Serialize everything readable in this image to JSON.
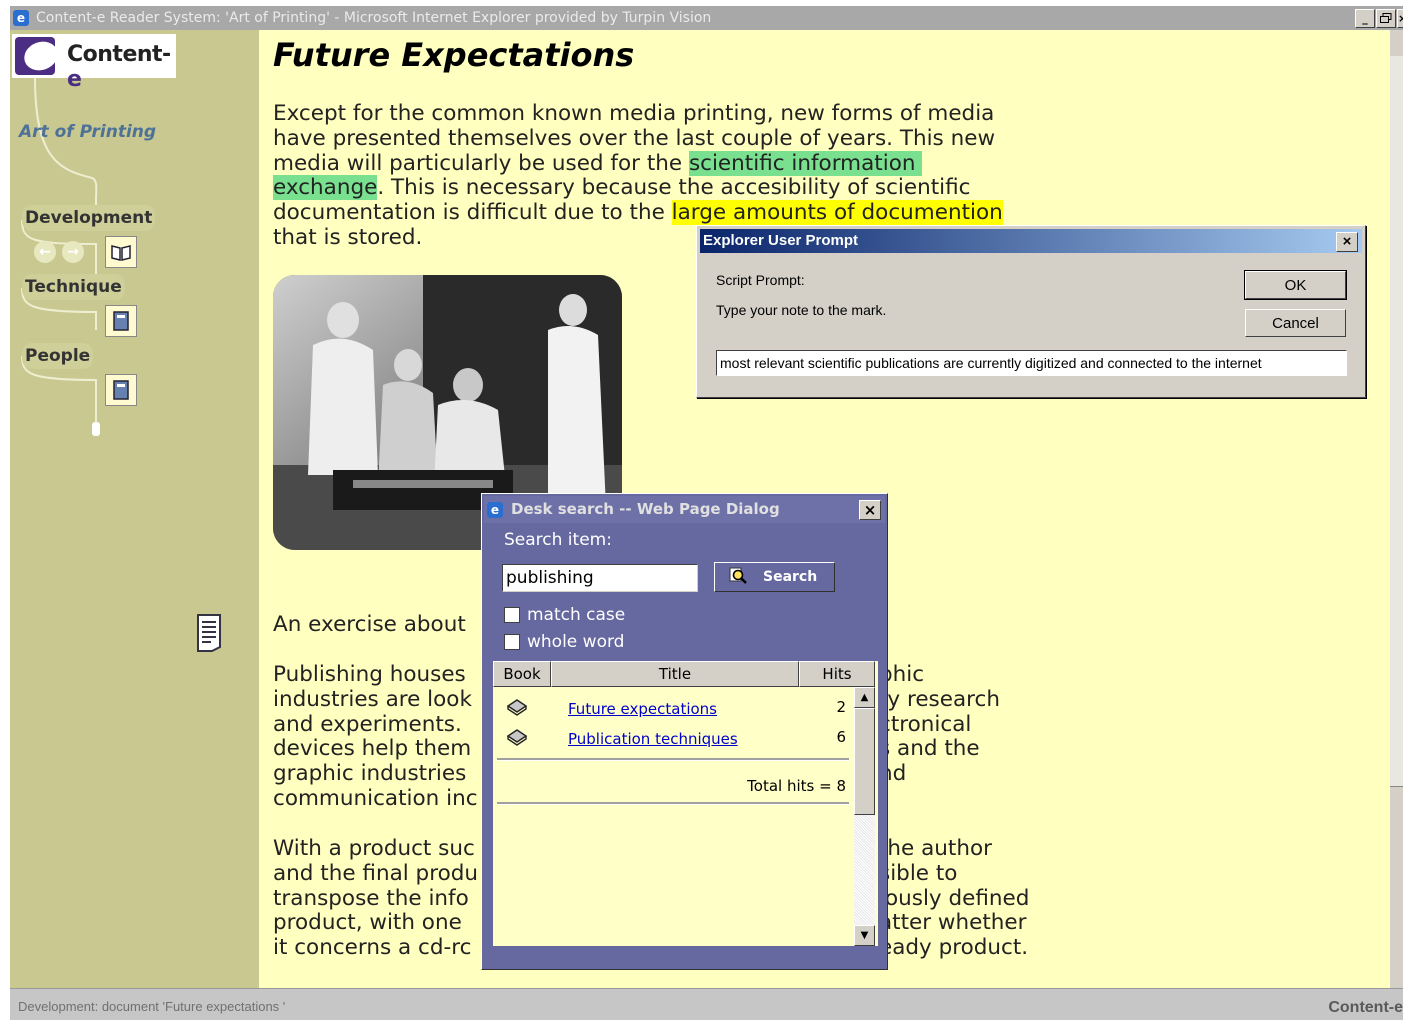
{
  "window": {
    "title": "Content-e Reader System: 'Art of Printing' - Microsoft Internet Explorer provided by Turpin Vision",
    "min_glyph": "_",
    "max_glyph": " ",
    "close_glyph": "×"
  },
  "sidebar": {
    "logo_text": "Content-",
    "logo_accent": "e",
    "book_title": "Art of Printing",
    "sections": [
      {
        "label": "Development"
      },
      {
        "label": "Technique"
      },
      {
        "label": "People"
      }
    ]
  },
  "content": {
    "heading": "Future Expectations",
    "para1_a": "Except for the common known media printing, new forms of media\nhave presented themselves over the last couple of years. This new\nmedia will particularly be used for the ",
    "para1_hl1": "scientific information \nexchange",
    "para1_b": ". This is necessary because the accesibility of scientific\ndocumentation is difficult due to the ",
    "para1_hl2": "large amounts of documention",
    "para1_c": "\nthat is stored.",
    "exercise_line": "An exercise about",
    "para2_left": "Publishing houses\nindustries are look\nand experiments.\ndevices help them\ngraphic industries\ncommunication inc",
    "para2_right": "phic\n)y research\nctronical\ns and the\nnd",
    "para3_left": "With a product suc\nand the final produ\ntranspose the info\nproduct, with one\nit concerns a cd-rc",
    "para3_right": "the author\nsible to\niously defined\natter whether\neady product."
  },
  "prompt": {
    "title": "Explorer User Prompt",
    "close": "×",
    "label1": "Script Prompt:",
    "label2": "Type your note to the mark.",
    "ok": "OK",
    "cancel": "Cancel",
    "value": "most relevant scientific publications are currently digitized and connected to the internet"
  },
  "desk_search": {
    "title": "Desk search -- Web Page Dialog",
    "close": "×",
    "search_item_label": "Search item:",
    "query": "publishing",
    "search_button": "Search",
    "match_case": "match case",
    "whole_word": "whole word",
    "columns": [
      "Book",
      "Title",
      "Hits"
    ],
    "results": [
      {
        "title": "Future expectations",
        "hits": "2"
      },
      {
        "title": "Publication techniques",
        "hits": "6"
      }
    ],
    "total": "Total hits = 8",
    "scroll_up": "▲",
    "scroll_down": "▼"
  },
  "status": {
    "text": "Development: document 'Future expectations '",
    "brand": "Content-e"
  },
  "colors": {
    "sidebar_bg": "#c8c890",
    "content_bg": "#ffffc0",
    "highlight_green": "#78e08e",
    "highlight_yellow": "#ffff00",
    "dialog_purple": "#6668a0",
    "link": "#0000cc"
  }
}
